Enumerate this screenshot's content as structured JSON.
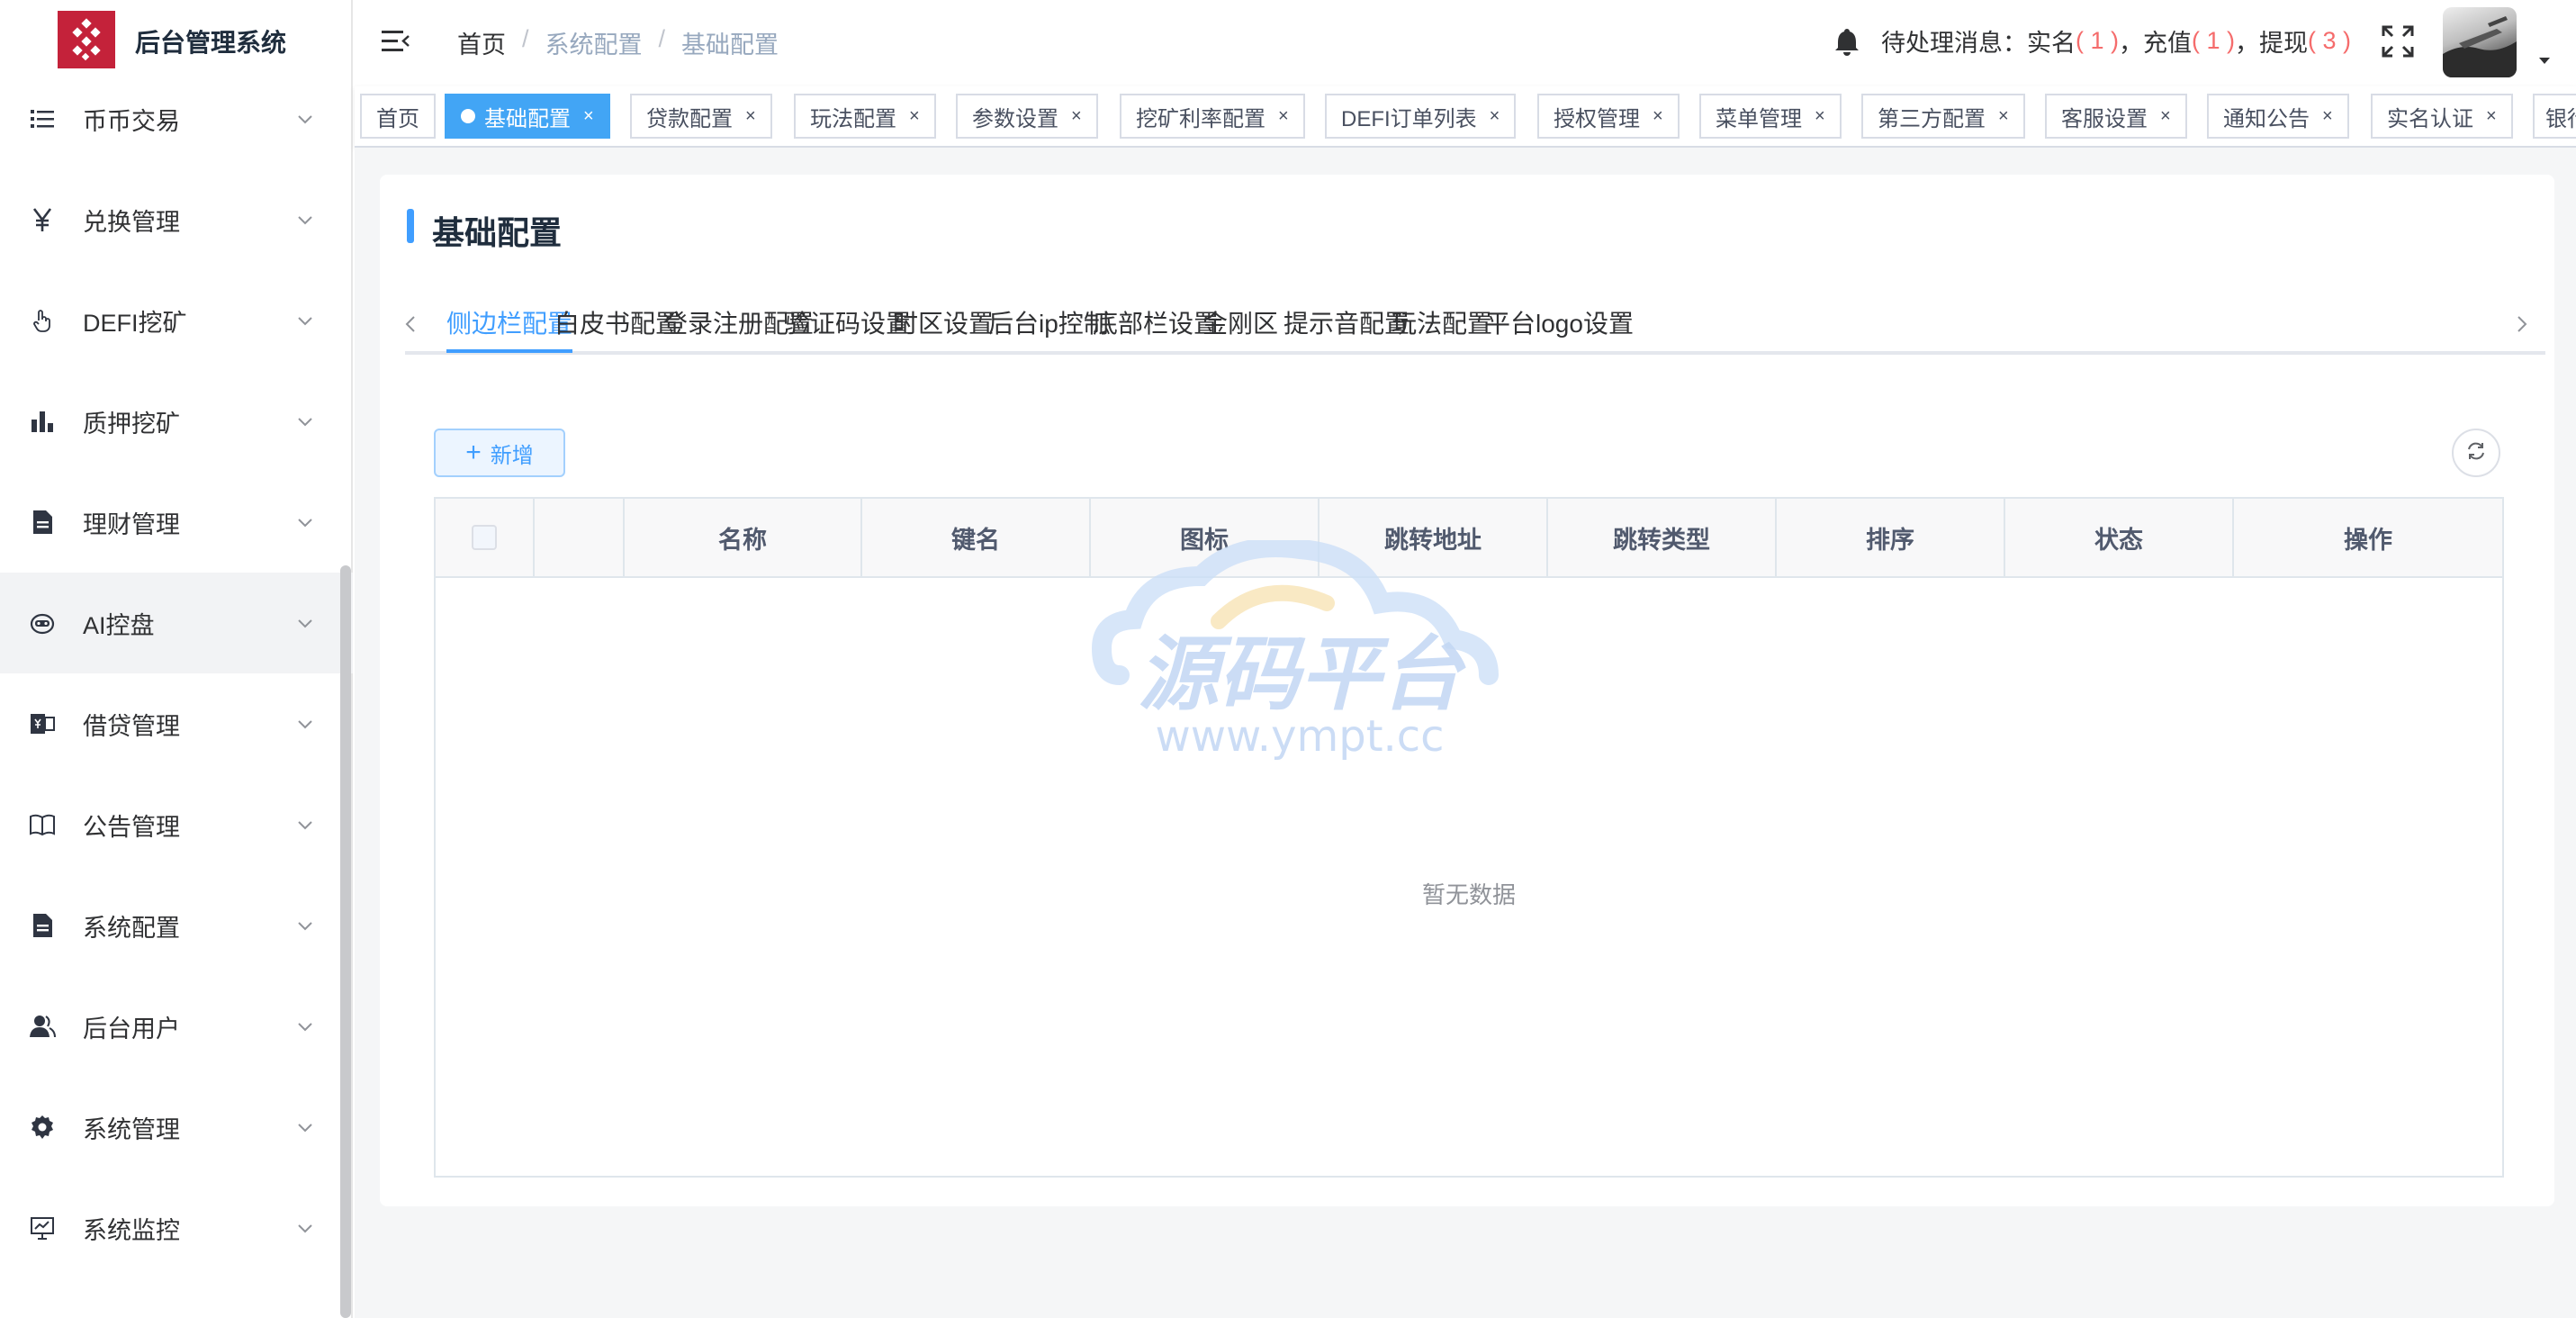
{
  "app": {
    "title": "后台管理系统"
  },
  "sidebar": {
    "items": [
      {
        "label": "币币交易",
        "icon": "list-icon"
      },
      {
        "label": "兑换管理",
        "icon": "yen-icon"
      },
      {
        "label": "DEFI挖矿",
        "icon": "pointer-hand-icon"
      },
      {
        "label": "质押挖矿",
        "icon": "bar-chart-icon"
      },
      {
        "label": "理财管理",
        "icon": "document-icon"
      },
      {
        "label": "AI控盘",
        "icon": "robot-icon"
      },
      {
        "label": "借贷管理",
        "icon": "loan-icon"
      },
      {
        "label": "公告管理",
        "icon": "book-icon"
      },
      {
        "label": "系统配置",
        "icon": "document-icon"
      },
      {
        "label": "后台用户",
        "icon": "user-icon"
      },
      {
        "label": "系统管理",
        "icon": "gear-icon"
      },
      {
        "label": "系统监控",
        "icon": "monitor-icon"
      }
    ]
  },
  "breadcrumb": {
    "items": [
      "首页",
      "系统配置",
      "基础配置"
    ],
    "separator": "/"
  },
  "notice": {
    "prefix": "待处理消息：",
    "realname_label": "实名",
    "realname_count": "( 1 )",
    "recharge_label": "，充值",
    "recharge_count": "( 1 )",
    "withdraw_label": "，提现",
    "withdraw_count": "( 3 )"
  },
  "tags": {
    "items": [
      "首页",
      "基础配置",
      "贷款配置",
      "玩法配置",
      "参数设置",
      "挖矿利率配置",
      "DEFI订单列表",
      "授权管理",
      "菜单管理",
      "第三方配置",
      "客服设置",
      "通知公告",
      "实名认证",
      "银行"
    ],
    "active_index": 1,
    "close_glyph": "×"
  },
  "card": {
    "title": "基础配置"
  },
  "tabs": {
    "items": [
      "侧边栏配置",
      "白皮书配置",
      "登录注册配置",
      "验证码设置",
      "时区设置",
      "后台ip控制",
      "底部栏设置",
      "金刚区",
      "提示音配置",
      "玩法配置",
      "平台logo设置"
    ],
    "active_index": 0
  },
  "toolbar": {
    "add_label": "新增",
    "add_glyph": "+"
  },
  "table": {
    "columns": [
      "",
      "",
      "名称",
      "键名",
      "图标",
      "跳转地址",
      "跳转类型",
      "排序",
      "状态",
      "操作"
    ],
    "empty_text": "暂无数据"
  },
  "watermark": {
    "text": "源码平台",
    "url": "www.ympt.cc"
  },
  "colors": {
    "primary": "#409eff",
    "tag_active": "#42a5f5",
    "logo": "#c4223a",
    "danger": "#f56c6c"
  }
}
